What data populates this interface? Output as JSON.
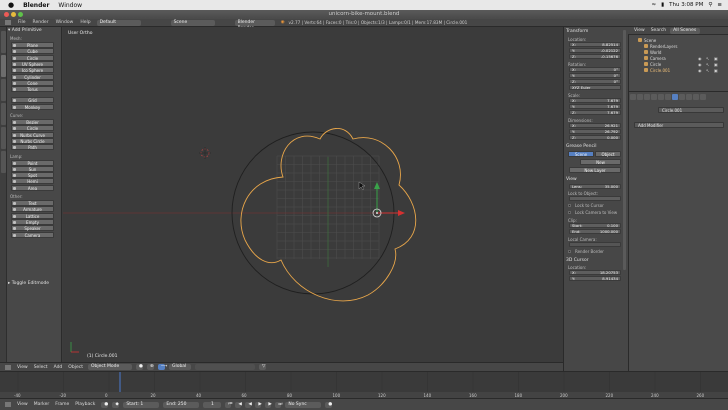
{
  "mac_menu": {
    "apple": "",
    "app": "Blender",
    "window": "Window",
    "clock": "Thu 3:08 PM"
  },
  "window": {
    "title": "unicorn-bike-mount.blend"
  },
  "info_header": {
    "menus": [
      "File",
      "Render",
      "Window",
      "Help"
    ],
    "layout": "Default",
    "scene": "Scene",
    "engine": "Blender Render",
    "stats": "v2.77 | Verts:64 | Faces:0 | Tris:0 | Objects:1/3 | Lamps:0/1 | Mem:17.83M | Circle.001"
  },
  "tool_shelf": {
    "panel_title": "Add Primitive",
    "groups": [
      {
        "label": "Mesh:",
        "items": [
          "Plane",
          "Cube",
          "Circle",
          "UV Sphere",
          "Ico Sphere",
          "Cylinder",
          "Cone",
          "Torus"
        ]
      },
      {
        "label": "",
        "items": [
          "Grid",
          "Monkey"
        ]
      },
      {
        "label": "Curve:",
        "items": [
          "Bezier",
          "Circle",
          "Nurbs Curve",
          "Nurbs Circle",
          "Path"
        ]
      },
      {
        "label": "Lamp:",
        "items": [
          "Point",
          "Sun",
          "Spot",
          "Hemi",
          "Area"
        ]
      },
      {
        "label": "Other:",
        "items": [
          "Text",
          "Armature",
          "Lattice",
          "Empty",
          "Speaker",
          "Camera"
        ]
      }
    ],
    "toggle_label": "Toggle Editmode"
  },
  "viewport": {
    "view_label": "User Ortho",
    "object_label": "(1) Circle.001"
  },
  "view_header": {
    "menus": [
      "View",
      "Select",
      "Add",
      "Object"
    ],
    "mode": "Object Mode",
    "orientation": "Global"
  },
  "n_panel": {
    "transform_title": "Transform",
    "location_label": "Location:",
    "location": [
      {
        "k": "X:",
        "v": "8.82514"
      },
      {
        "k": "Y:",
        "v": "-0.02122"
      },
      {
        "k": "Z:",
        "v": "-0.15676"
      }
    ],
    "rotation_label": "Rotation:",
    "rotation": [
      {
        "k": "X:",
        "v": "0°"
      },
      {
        "k": "Y:",
        "v": "0°"
      },
      {
        "k": "Z:",
        "v": "0°"
      }
    ],
    "rotation_mode": "XYZ Euler",
    "scale_label": "Scale:",
    "scale": [
      {
        "k": "X:",
        "v": "7.679"
      },
      {
        "k": "Y:",
        "v": "7.679"
      },
      {
        "k": "Z:",
        "v": "7.679"
      }
    ],
    "dimensions_label": "Dimensions:",
    "dimensions": [
      {
        "k": "X:",
        "v": "26.921"
      },
      {
        "k": "Y:",
        "v": "26.792"
      },
      {
        "k": "Z:",
        "v": "0.000"
      }
    ],
    "grease_title": "Grease Pencil",
    "grease_tabs": [
      "Scene",
      "Object"
    ],
    "new_label": "New",
    "new_layer": "New Layer",
    "view_title": "View",
    "lens": {
      "k": "Lens:",
      "v": "35.000"
    },
    "lock_object": "Lock to Object:",
    "lock_cursor": "Lock to Cursor",
    "lock_camera": "Lock Camera to View",
    "clip_label": "Clip:",
    "clip": [
      {
        "k": "Start:",
        "v": "0.100"
      },
      {
        "k": "End:",
        "v": "1000.000"
      }
    ],
    "local_camera": "Local Camera:",
    "render_border": "Render Border",
    "cursor_title": "3D Cursor",
    "cursor_location": "Location:",
    "cursor": [
      {
        "k": "X:",
        "v": "18.20753"
      },
      {
        "k": "Y:",
        "v": "8.91434"
      }
    ]
  },
  "outliner": {
    "menus": [
      "View",
      "Search",
      "All Scenes"
    ],
    "items": [
      "Scene",
      "RenderLayers",
      "World",
      "Camera",
      "Circle",
      "Circle.001"
    ]
  },
  "properties": {
    "object_name": "Circle.001",
    "add_modifier": "Add Modifier"
  },
  "timeline": {
    "menus": [
      "View",
      "Marker",
      "Frame",
      "Playback"
    ],
    "start": {
      "k": "Start:",
      "v": "1"
    },
    "end": {
      "k": "End:",
      "v": "250"
    },
    "current": "1",
    "sync": "No Sync",
    "ticks": [
      "-40",
      "-20",
      "0",
      "20",
      "40",
      "60",
      "80",
      "100",
      "120",
      "140",
      "160",
      "180",
      "200",
      "220",
      "240",
      "260"
    ]
  },
  "colors": {
    "selected_outline": "#e8a64a",
    "x_axis": "#d63131",
    "y_axis": "#3aa34a",
    "accent": "#5680c2"
  }
}
